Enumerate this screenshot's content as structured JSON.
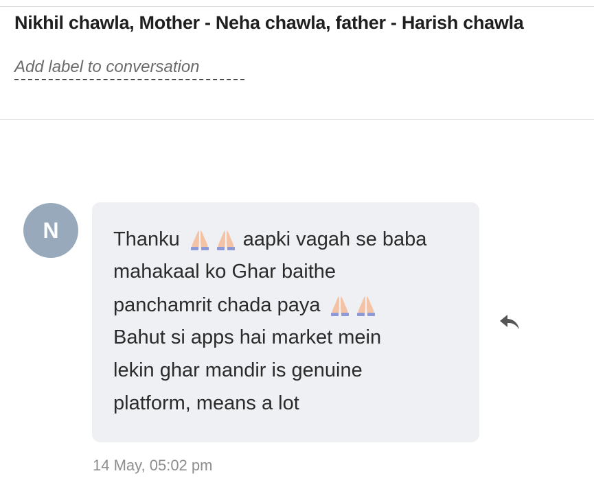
{
  "conversation": {
    "title": "Nikhil chawla, Mother - Neha chawla, father - Harish chawla",
    "label_placeholder": "Add label to conversation"
  },
  "message": {
    "avatar_initial": "N",
    "avatar_color": "#98a9bc",
    "bubble_color": "#eef0f3",
    "lines": {
      "l1_before": "Thanku",
      "l1_after": "aapki vagah se baba",
      "l2": "mahakaal ko Ghar baithe",
      "l3": "panchamrit chada paya",
      "l4": "Bahut si apps hai market mein",
      "l5": "lekin ghar mandir is genuine",
      "l6": "platform, means a lot"
    },
    "emoji": "folded-hands-emoji",
    "timestamp": "14 May, 05:02 pm"
  },
  "actions": {
    "reply_icon": "reply-arrow-icon"
  }
}
